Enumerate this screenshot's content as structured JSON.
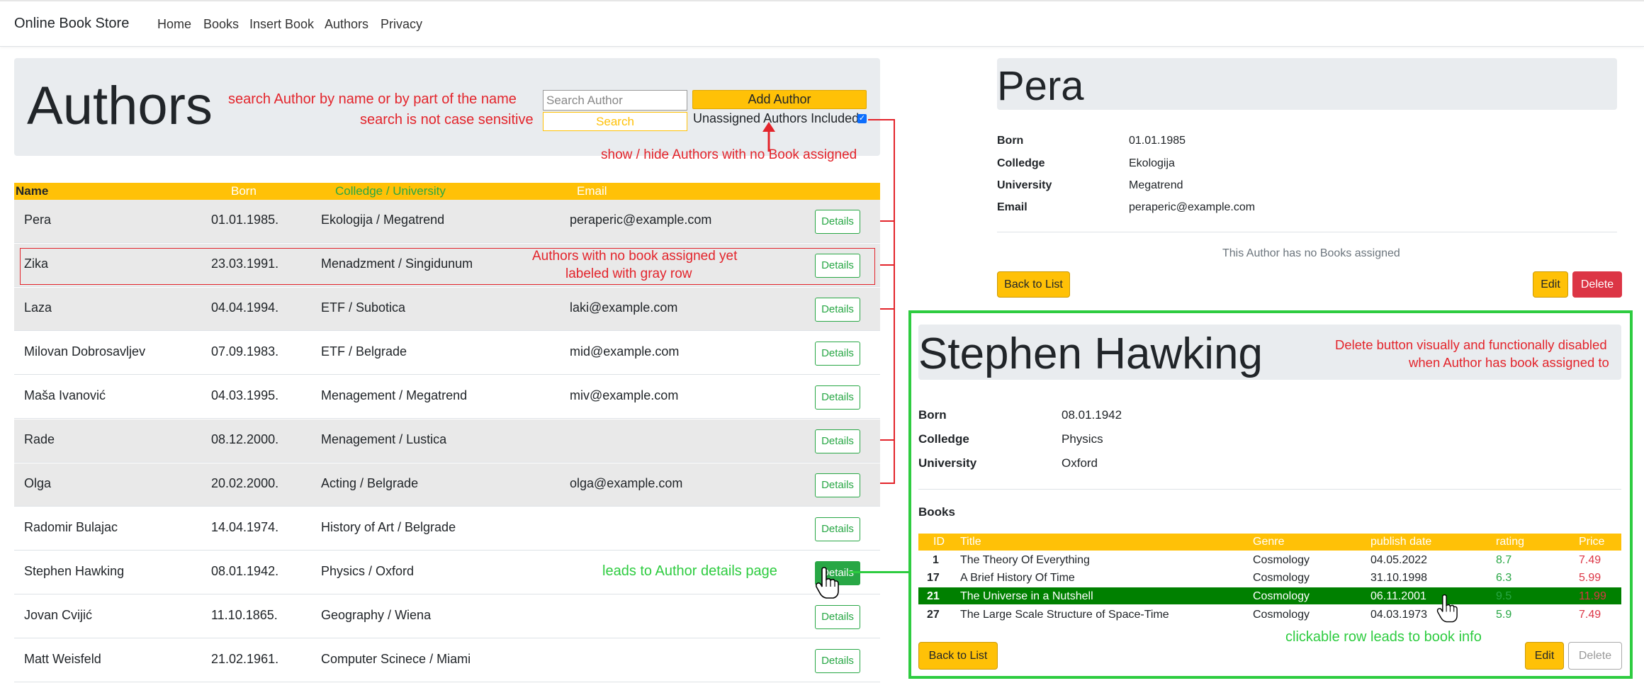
{
  "navbar": {
    "brand": "Online Book Store",
    "links": [
      "Home",
      "Books",
      "Insert Book",
      "Authors",
      "Privacy"
    ]
  },
  "authors_page": {
    "title": "Authors",
    "search": {
      "placeholder": "Search Author",
      "button_label": "Search"
    },
    "add_author_label": "Add Author",
    "unassigned_label": "Unassigned Authors Included",
    "unassigned_checked": true,
    "columns": [
      "Name",
      "Born",
      "Colledge / University",
      "Email"
    ],
    "rows": [
      {
        "name": "Pera",
        "born": "01.01.1985.",
        "school": "Ekologija / Megatrend",
        "email": "peraperic@example.com",
        "action": "Details",
        "no_book": true
      },
      {
        "name": "Zika",
        "born": "23.03.1991.",
        "school": "Menadzment / Singidunum",
        "email": "",
        "action": "Details",
        "no_book": true
      },
      {
        "name": "Laza",
        "born": "04.04.1994.",
        "school": "ETF / Subotica",
        "email": "laki@example.com",
        "action": "Details",
        "no_book": true
      },
      {
        "name": "Milovan Dobrosavljev",
        "born": "07.09.1983.",
        "school": "ETF / Belgrade",
        "email": "mid@example.com",
        "action": "Details",
        "no_book": false
      },
      {
        "name": "Maša Ivanović",
        "born": "04.03.1995.",
        "school": "Menagement / Megatrend",
        "email": "miv@example.com",
        "action": "Details",
        "no_book": false
      },
      {
        "name": "Rade",
        "born": "08.12.2000.",
        "school": "Menagement / Lustica",
        "email": "",
        "action": "Details",
        "no_book": true
      },
      {
        "name": "Olga",
        "born": "20.02.2000.",
        "school": "Acting / Belgrade",
        "email": "olga@example.com",
        "action": "Details",
        "no_book": true
      },
      {
        "name": "Radomir Bulajac",
        "born": "14.04.1974.",
        "school": "History of Art / Belgrade",
        "email": "",
        "action": "Details",
        "no_book": false
      },
      {
        "name": "Stephen Hawking",
        "born": "08.01.1942.",
        "school": "Physics / Oxford",
        "email": "",
        "action": "Details",
        "no_book": false
      },
      {
        "name": "Jovan Cvijić",
        "born": "11.10.1865.",
        "school": "Geography / Wiena",
        "email": "",
        "action": "Details",
        "no_book": false
      },
      {
        "name": "Matt Weisfeld",
        "born": "21.02.1961.",
        "school": "Computer Scinece / Miami",
        "email": "",
        "action": "Details",
        "no_book": false
      }
    ]
  },
  "annotations": {
    "search_1": "search Author by name or by part of the name",
    "search_2": "search is not case sensitive",
    "show_hide": "show / hide Authors with no Book assigned",
    "no_book_1": "Authors with no book assigned yet",
    "no_book_2": "labeled with gray row",
    "details_link": "leads to Author details page",
    "delete_1": "Delete button visually and functionally disabled",
    "delete_2": "when Author has book assigned to",
    "clickable_row": "clickable row leads to book info"
  },
  "pera_details": {
    "name": "Pera",
    "fields": [
      {
        "label": "Born",
        "value": "01.01.1985"
      },
      {
        "label": "Colledge",
        "value": "Ekologija"
      },
      {
        "label": "University",
        "value": "Megatrend"
      },
      {
        "label": "Email",
        "value": "peraperic@example.com"
      }
    ],
    "no_books_text": "This Author has no Books assigned",
    "back_label": "Back to List",
    "edit_label": "Edit",
    "delete_label": "Delete"
  },
  "hawking_details": {
    "name": "Stephen Hawking",
    "fields": [
      {
        "label": "Born",
        "value": "08.01.1942"
      },
      {
        "label": "Colledge",
        "value": "Physics"
      },
      {
        "label": "University",
        "value": "Oxford"
      }
    ],
    "books_label": "Books",
    "book_columns": [
      "ID",
      "Title",
      "Genre",
      "publish date",
      "rating",
      "Price"
    ],
    "books": [
      {
        "id": "1",
        "title": "The Theory Of Everything",
        "genre": "Cosmology",
        "date": "04.05.2022",
        "rating": "8.7",
        "price": "7.49",
        "selected": false
      },
      {
        "id": "17",
        "title": "A Brief History Of Time",
        "genre": "Cosmology",
        "date": "31.10.1998",
        "rating": "6.3",
        "price": "5.99",
        "selected": false
      },
      {
        "id": "21",
        "title": "The Universe in a Nutshell",
        "genre": "Cosmology",
        "date": "06.11.2001",
        "rating": "9.5",
        "price": "11.99",
        "selected": true
      },
      {
        "id": "27",
        "title": "The Large Scale Structure of Space-Time",
        "genre": "Cosmology",
        "date": "04.03.1973",
        "rating": "5.9",
        "price": "7.49",
        "selected": false
      }
    ],
    "back_label": "Back to List",
    "edit_label": "Edit",
    "delete_label": "Delete"
  },
  "colors": {
    "warning": "#ffc107",
    "success": "#28a745",
    "danger": "#dc3545",
    "annotation_red": "#e3242b",
    "annotation_green": "#2ecc40",
    "selected_row": "#008000"
  }
}
